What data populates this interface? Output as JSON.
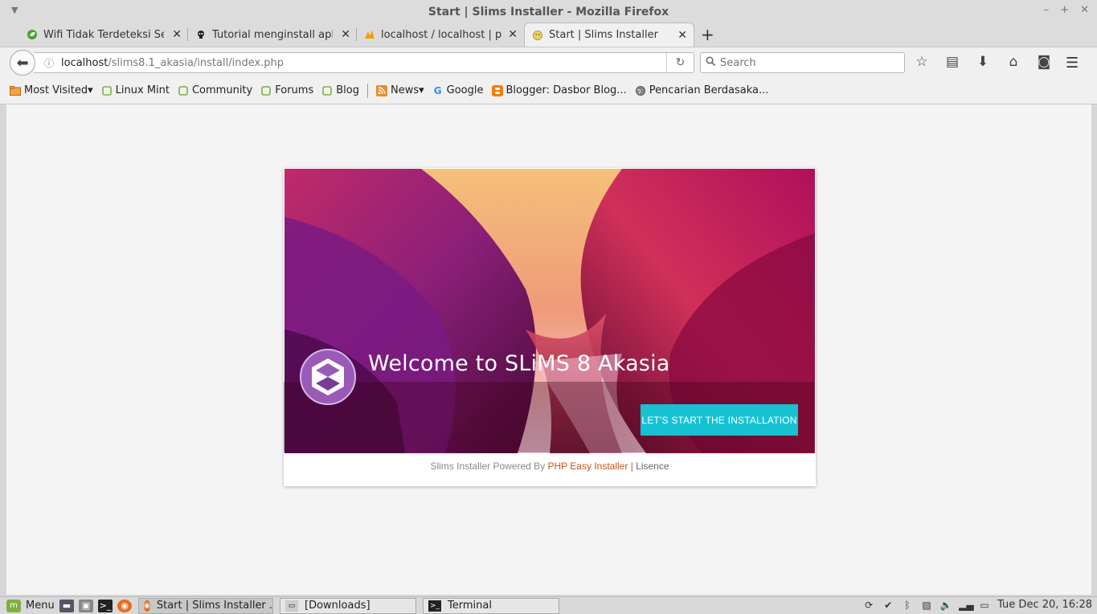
{
  "window": {
    "title": "Start | Slims Installer - Mozilla Firefox"
  },
  "tabs": [
    {
      "label": "Wifi Tidak Terdeteksi Set...",
      "icon": "leaf-favicon-icon"
    },
    {
      "label": "Tutorial menginstall aplik...",
      "icon": "skull-favicon-icon"
    },
    {
      "label": "localhost / localhost | ph...",
      "icon": "pma-favicon-icon"
    },
    {
      "label": "Start | Slims Installer",
      "icon": "smiley-favicon-icon",
      "active": true
    }
  ],
  "navbar": {
    "url_host": "localhost",
    "url_path": "/slims8.1_akasia/install/index.php",
    "search_placeholder": "Search"
  },
  "bookmarks": [
    {
      "label": "Most Visited",
      "dropdown": true
    },
    {
      "label": "Linux Mint"
    },
    {
      "label": "Community"
    },
    {
      "label": "Forums"
    },
    {
      "label": "Blog"
    },
    {
      "label": "News",
      "dropdown": true
    },
    {
      "label": "Google"
    },
    {
      "label": "Blogger: Dasbor Blog..."
    },
    {
      "label": "Pencarian Berdasaka..."
    }
  ],
  "installer": {
    "welcome": "Welcome to SLiMS 8 Akasia",
    "start_button": "LET'S START THE INSTALLATION",
    "footer_prefix": "Slims Installer Powered By",
    "footer_link": "PHP Easy Installer",
    "footer_sep": "|",
    "footer_license": "Lisence"
  },
  "taskbar": {
    "menu_label": "Menu",
    "windows": [
      {
        "label": "Start | Slims Installer ...",
        "active": true
      },
      {
        "label": "[Downloads]"
      },
      {
        "label": "Terminal"
      }
    ],
    "clock": "Tue Dec 20, 16:28"
  },
  "colors": {
    "accent_button": "#16c2d2",
    "footer_link": "#c4541a",
    "mint_green": "#7fb03f"
  }
}
